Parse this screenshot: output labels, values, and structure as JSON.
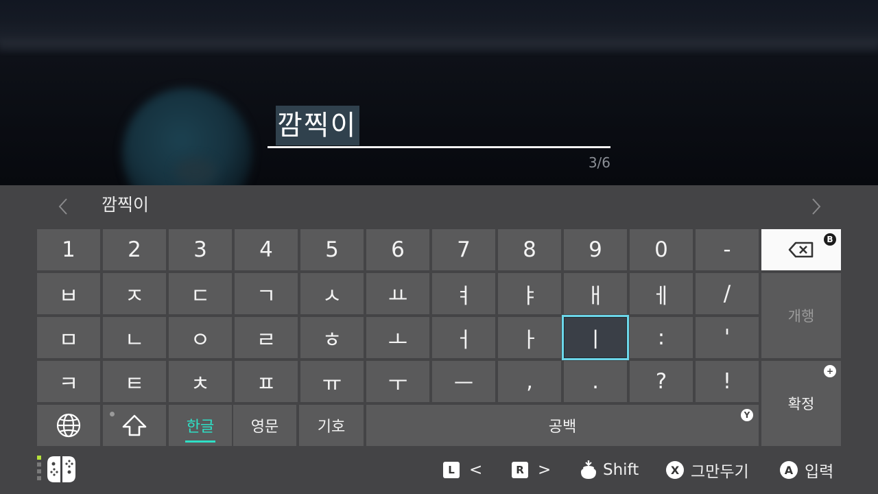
{
  "input": {
    "text": "깜찍이",
    "count": "3/6"
  },
  "prediction": {
    "word": "깜찍이"
  },
  "keys": {
    "row1": [
      "1",
      "2",
      "3",
      "4",
      "5",
      "6",
      "7",
      "8",
      "9",
      "0",
      "-"
    ],
    "row2": [
      "ㅂ",
      "ㅈ",
      "ㄷ",
      "ㄱ",
      "ㅅ",
      "ㅛ",
      "ㅕ",
      "ㅑ",
      "ㅐ",
      "ㅔ",
      "/"
    ],
    "row3": [
      "ㅁ",
      "ㄴ",
      "ㅇ",
      "ㄹ",
      "ㅎ",
      "ㅗ",
      "ㅓ",
      "ㅏ",
      "ㅣ",
      ":",
      "'"
    ],
    "row4": [
      "ㅋ",
      "ㅌ",
      "ㅊ",
      "ㅍ",
      "ㅠ",
      "ㅜ",
      "ㅡ",
      ",",
      ".",
      "?",
      "!"
    ],
    "selected": "ㅣ"
  },
  "side": {
    "backspace_badge": "B",
    "enter": "개행",
    "confirm": "확정",
    "confirm_badge": "+"
  },
  "bottom": {
    "hangul": "한글",
    "english": "영문",
    "symbols": "기호",
    "space": "공백",
    "space_badge": "Y"
  },
  "footer": {
    "l_button": "L",
    "l_label": "<",
    "r_button": "R",
    "r_label": ">",
    "shift": "Shift",
    "x_button": "X",
    "cancel": "그만두기",
    "a_button": "A",
    "ok": "입력"
  },
  "colors": {
    "panel": "#444446",
    "key": "#5a5a5b",
    "accent": "#2ee0c6",
    "selection": "#6cd7ea"
  }
}
